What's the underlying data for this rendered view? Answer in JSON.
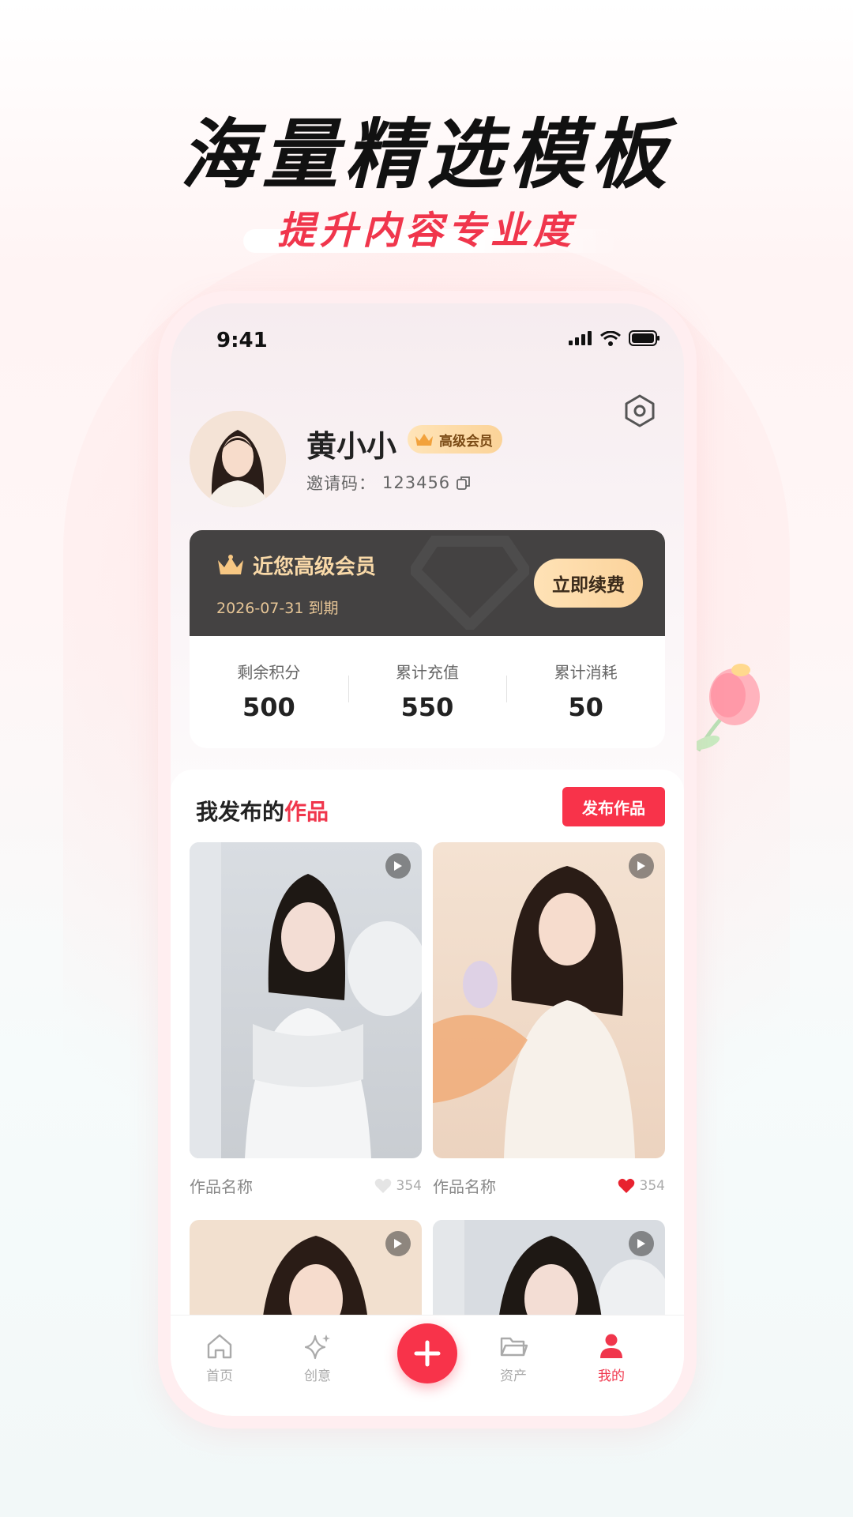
{
  "promo": {
    "headline": "海量精选模板",
    "subheadline": "提升内容专业度"
  },
  "status_bar": {
    "time": "9:41"
  },
  "profile": {
    "name": "黄小小",
    "badge": "高级会员",
    "invite_label": "邀请码：",
    "invite_code": "123456"
  },
  "membership": {
    "title": "近您高级会员",
    "expire_text": "2026-07-31 到期",
    "renew_label": "立即续费",
    "accent": "#f9d9a8"
  },
  "stats": [
    {
      "label": "剩余积分",
      "value": "500"
    },
    {
      "label": "累计充值",
      "value": "550"
    },
    {
      "label": "累计消耗",
      "value": "50"
    }
  ],
  "works": {
    "title_prefix": "我发布的",
    "title_highlight": "作品",
    "publish_label": "发布作品",
    "items": [
      {
        "name": "作品名称",
        "likes": "354",
        "liked": false
      },
      {
        "name": "作品名称",
        "likes": "354",
        "liked": true
      },
      {
        "name": "",
        "likes": "",
        "liked": false
      },
      {
        "name": "",
        "likes": "",
        "liked": false
      }
    ]
  },
  "tabbar": {
    "items": [
      {
        "label": "首页",
        "icon": "home-icon"
      },
      {
        "label": "创意",
        "icon": "sparkle-icon"
      },
      {
        "label": "",
        "icon": "plus-icon"
      },
      {
        "label": "资产",
        "icon": "folder-icon"
      },
      {
        "label": "我的",
        "icon": "user-icon",
        "active": true
      }
    ]
  },
  "colors": {
    "brand": "#f8334a",
    "vip_card": "#444242"
  }
}
